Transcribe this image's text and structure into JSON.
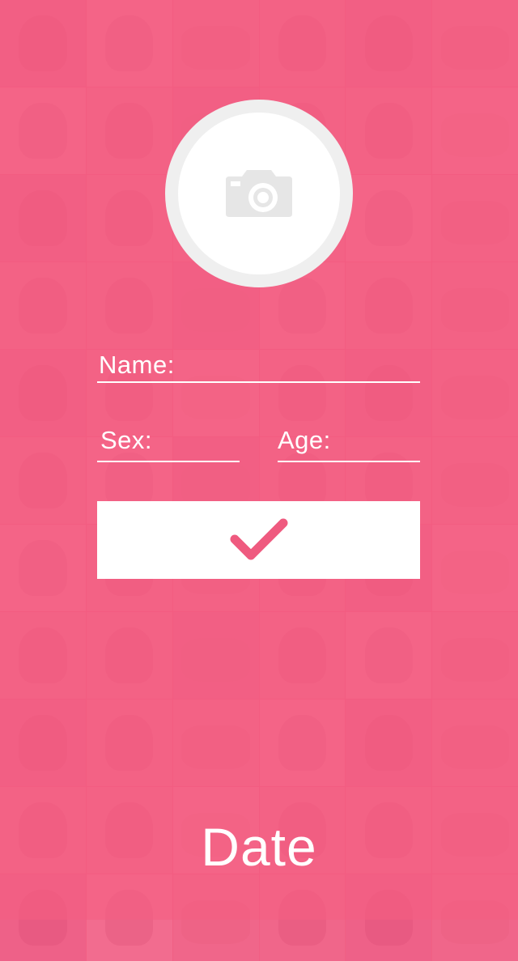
{
  "form": {
    "name_label": "Name:",
    "sex_label": "Sex:",
    "age_label": "Age:"
  },
  "avatar": {
    "icon": "camera-icon"
  },
  "confirm": {
    "icon": "checkmark-icon"
  },
  "brand": {
    "text": "Date"
  },
  "colors": {
    "background": "#f15f84",
    "accent": "#ef5a7f",
    "foreground": "#ffffff",
    "avatar_ring": "#efefef",
    "camera_icon": "#e6e6e6"
  }
}
